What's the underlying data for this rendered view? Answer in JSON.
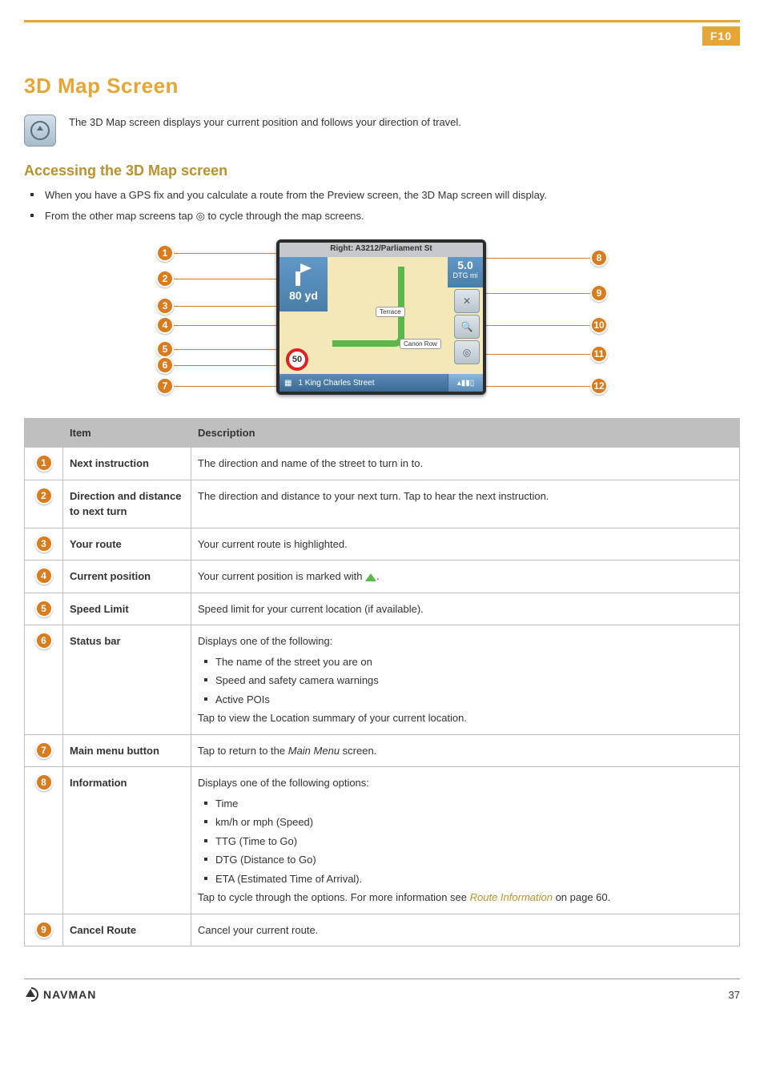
{
  "page": {
    "product_badge": "F10",
    "number": "37"
  },
  "logo_text": "NAVMAN",
  "title": "3D Map Screen",
  "intro": "The 3D Map screen displays your current position and follows your direction of travel.",
  "access": {
    "heading": "Accessing the 3D Map screen",
    "items": [
      "When you have a GPS fix and you calculate a route from the Preview screen, the 3D Map screen will display.",
      "From the other map screens tap ◎ to cycle through the map screens."
    ]
  },
  "device": {
    "top_bar": "Right: A3212/Parliament St",
    "turn_dist": "80 yd",
    "dtg_label": "DTG",
    "dtg_val": "5.0",
    "dtg_unit": "mi",
    "speed": "50",
    "street_label_1": "Terrace",
    "street_label_2": "Canon Row",
    "bottom_addr": "1 King Charles Street"
  },
  "table": {
    "headers": [
      "",
      "Item",
      "Description"
    ],
    "rows": [
      {
        "n": "1",
        "item": "Next instruction",
        "desc": "The direction and name of the street to turn in to."
      },
      {
        "n": "2",
        "item": "Direction and distance to next turn",
        "desc": "The direction and distance to your next turn. Tap to hear the next instruction."
      },
      {
        "n": "3",
        "item": "Your route",
        "desc": "Your current route is highlighted."
      },
      {
        "n": "4",
        "item": "Current position",
        "desc_prefix": "Your current position is marked with ",
        "desc_suffix": "."
      },
      {
        "n": "5",
        "item": "Speed Limit",
        "desc": "Speed limit for your current location (if available)."
      },
      {
        "n": "6",
        "item": "Status bar",
        "desc_intro": "Displays one of the following:",
        "bullets": [
          "The name of the street you are on",
          "Speed and safety camera warnings",
          "Active POIs"
        ],
        "desc_outro": "Tap to view the Location summary of your current location."
      },
      {
        "n": "7",
        "item": "Main menu button",
        "desc_prefix": "Tap to return to the ",
        "desc_em": "Main Menu",
        "desc_suffix": " screen."
      },
      {
        "n": "8",
        "item": "Information",
        "desc_intro": "Displays one of the following options:",
        "bullets": [
          "Time",
          "km/h or mph (Speed)",
          "TTG (Time to Go)",
          "DTG (Distance to Go)",
          "ETA (Estimated Time of Arrival)."
        ],
        "desc_outro_parts": [
          "Tap to cycle through the options. For more information see ",
          "Route Information",
          " on page 60."
        ]
      },
      {
        "n": "9",
        "item": "Cancel Route",
        "desc": "Cancel your current route."
      }
    ]
  }
}
